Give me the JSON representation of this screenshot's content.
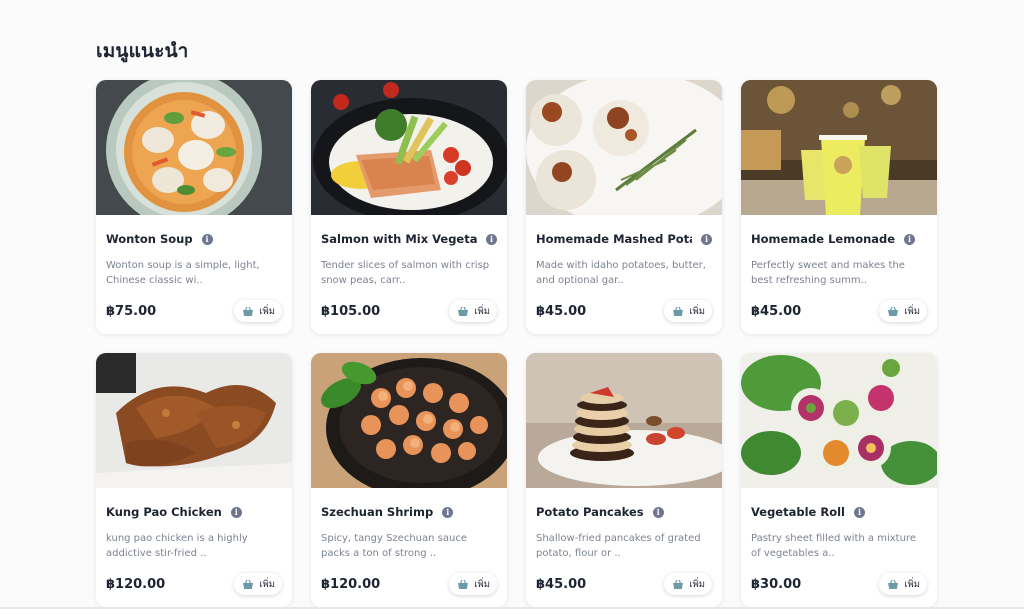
{
  "section": {
    "title": "เมนูแนะนำ"
  },
  "add_label": "เพิ่ม",
  "colors": {
    "accent_icon": "#6b9aa8",
    "info_badge": "#6f7690",
    "price": "#1f2433"
  },
  "items": [
    {
      "title": "Wonton Soup",
      "desc": "Wonton soup is a simple, light, Chinese classic wi..",
      "price": "฿75.00",
      "image": "wonton-soup-bowl"
    },
    {
      "title": "Salmon with Mix Vegeta...",
      "desc": "Tender slices of salmon with crisp snow peas, carr..",
      "price": "฿105.00",
      "image": "salmon-plate"
    },
    {
      "title": "Homemade Mashed Potato",
      "desc": "Made with idaho potatoes, butter, and optional gar..",
      "price": "฿45.00",
      "image": "mashed-potato-balls"
    },
    {
      "title": "Homemade Lemonade",
      "desc": "Perfectly sweet and makes the best refreshing summ..",
      "price": "฿45.00",
      "image": "lemonade-cups"
    },
    {
      "title": "Kung Pao Chicken",
      "desc": "kung pao chicken is a highly addictive stir-fried ..",
      "price": "฿120.00",
      "image": "fried-chicken"
    },
    {
      "title": "Szechuan Shrimp",
      "desc": "Spicy, tangy Szechuan sauce packs a ton of strong ..",
      "price": "฿120.00",
      "image": "shrimp-pan"
    },
    {
      "title": "Potato Pancakes",
      "desc": "Shallow-fried pancakes of grated potato, flour or ..",
      "price": "฿45.00",
      "image": "pancake-stack"
    },
    {
      "title": "Vegetable Roll",
      "desc": "Pastry sheet filled with a mixture of vegetables a..",
      "price": "฿30.00",
      "image": "vegetable-rolls"
    }
  ]
}
